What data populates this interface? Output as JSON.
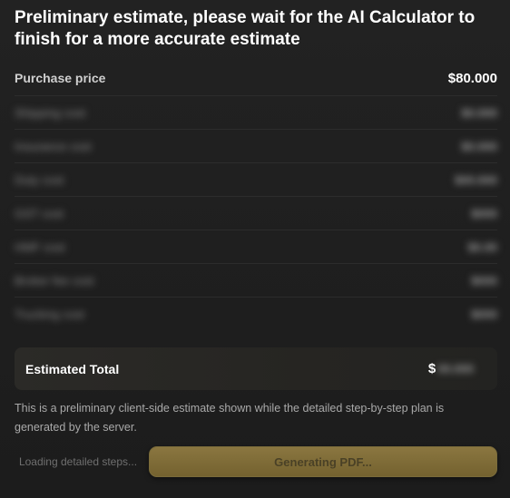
{
  "header": {
    "title": "Preliminary estimate, please wait for the AI Calculator to finish for a more accurate estimate"
  },
  "rows": [
    {
      "label": "Purchase price",
      "value": "$80.000",
      "blurred": false
    },
    {
      "label": "Shipping cost",
      "value": "$0.000",
      "blurred": true
    },
    {
      "label": "Insurance cost",
      "value": "$0.000",
      "blurred": true
    },
    {
      "label": "Duty cost",
      "value": "$00.000",
      "blurred": true
    },
    {
      "label": "GST cost",
      "value": "$000",
      "blurred": true
    },
    {
      "label": "HMF cost",
      "value": "$0.00",
      "blurred": true
    },
    {
      "label": "Broker fee cost",
      "value": "$000",
      "blurred": true
    },
    {
      "label": "Trucking cost",
      "value": "$000",
      "blurred": true
    }
  ],
  "total": {
    "label": "Estimated Total",
    "currency": "$",
    "value": "00.000"
  },
  "note": "This is a preliminary client-side estimate shown while the detailed step-by-step plan is generated by the server.",
  "footer": {
    "loading_text": "Loading detailed steps...",
    "pdf_button_label": "Generating PDF..."
  },
  "colors": {
    "background": "#1f1f1f",
    "button_gold": "#8a7640",
    "button_text": "#4a4126"
  }
}
